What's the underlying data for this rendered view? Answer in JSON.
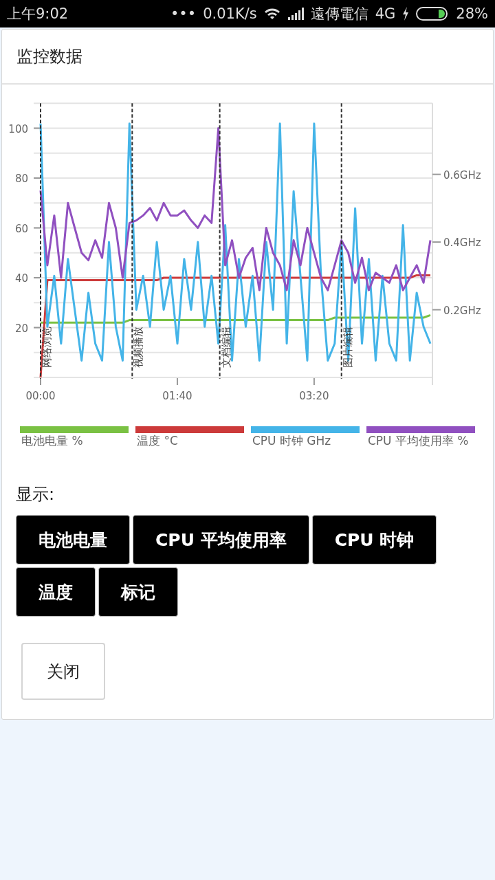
{
  "status_bar": {
    "time": "上午9:02",
    "dots": "•••",
    "speed": "0.01K/s",
    "carrier": "遠傳電信",
    "network": "4G",
    "battery": "28%"
  },
  "dialog": {
    "title": "监控数据",
    "chart": {
      "chart_data": {
        "type": "line",
        "x": [
          0,
          5,
          10,
          15,
          20,
          25,
          30,
          35,
          40,
          45,
          50,
          55,
          60,
          65,
          70,
          75,
          80,
          85,
          90,
          95,
          100,
          105,
          110,
          115,
          120,
          125,
          130,
          135,
          140,
          145,
          150,
          155,
          160,
          165,
          170,
          175,
          180,
          185,
          190,
          195,
          200,
          205,
          210,
          215,
          220,
          225,
          230,
          235,
          240,
          245,
          250,
          255,
          260,
          265,
          270,
          275,
          280,
          285
        ],
        "xlim": [
          0,
          287
        ],
        "ylim": [
          0,
          110
        ],
        "y2lim": [
          0,
          0.81
        ],
        "xticks": [
          {
            "value": 0,
            "label": "00:00"
          },
          {
            "value": 100,
            "label": "01:40"
          },
          {
            "value": 200,
            "label": "03:20"
          }
        ],
        "yticks": [
          20,
          40,
          60,
          80,
          100
        ],
        "y2ticks": [
          {
            "value": 0.2,
            "label": "0.2GHz"
          },
          {
            "value": 0.4,
            "label": "0.4GHz"
          },
          {
            "value": 0.6,
            "label": "0.6GHz"
          }
        ],
        "series": [
          {
            "name": "电池电量 %",
            "color": "#7ac143",
            "values": [
              22,
              22,
              22,
              22,
              22,
              22,
              22,
              22,
              22,
              22,
              22,
              22,
              22,
              23,
              23,
              23,
              23,
              23,
              23,
              23,
              23,
              23,
              23,
              23,
              23,
              23,
              23,
              23,
              23,
              23,
              23,
              23,
              23,
              23,
              23,
              23,
              23,
              23,
              23,
              23,
              23,
              23,
              23,
              24,
              24,
              24,
              24,
              24,
              24,
              24,
              24,
              24,
              24,
              24,
              24,
              24,
              24,
              25
            ]
          },
          {
            "name": "温度 °C",
            "color": "#cc3a3a",
            "values": [
              0,
              39,
              39,
              39,
              39,
              39,
              39,
              39,
              39,
              39,
              39,
              39,
              39,
              39,
              39,
              39,
              39,
              39,
              40,
              40,
              40,
              40,
              40,
              40,
              40,
              40,
              40,
              40,
              40,
              40,
              40,
              40,
              40,
              40,
              40,
              40,
              40,
              40,
              40,
              40,
              40,
              40,
              40,
              40,
              40,
              40,
              40,
              40,
              40,
              40,
              40,
              40,
              40,
              40,
              40,
              41,
              41,
              41
            ]
          },
          {
            "name": "CPU 时钟 GHz",
            "color": "#44b4e8",
            "axis": "y2",
            "values": [
              0.75,
              0.15,
              0.3,
              0.1,
              0.35,
              0.2,
              0.05,
              0.25,
              0.1,
              0.05,
              0.4,
              0.15,
              0.05,
              0.75,
              0.2,
              0.3,
              0.15,
              0.4,
              0.2,
              0.3,
              0.1,
              0.35,
              0.2,
              0.4,
              0.15,
              0.3,
              0.1,
              0.45,
              0.05,
              0.35,
              0.15,
              0.3,
              0.05,
              0.4,
              0.2,
              0.75,
              0.1,
              0.55,
              0.3,
              0.05,
              0.75,
              0.3,
              0.05,
              0.1,
              0.4,
              0.05,
              0.5,
              0.1,
              0.35,
              0.05,
              0.3,
              0.1,
              0.05,
              0.45,
              0.05,
              0.25,
              0.15,
              0.1
            ]
          },
          {
            "name": "CPU 平均使用率 %",
            "color": "#9050c0",
            "values": [
              75,
              45,
              65,
              40,
              70,
              60,
              50,
              47,
              55,
              48,
              70,
              60,
              40,
              62,
              63,
              65,
              68,
              63,
              70,
              65,
              65,
              67,
              63,
              60,
              65,
              62,
              100,
              45,
              55,
              40,
              48,
              52,
              35,
              60,
              50,
              45,
              35,
              55,
              45,
              60,
              50,
              40,
              35,
              45,
              55,
              50,
              38,
              48,
              35,
              42,
              40,
              38,
              45,
              35,
              40,
              45,
              38,
              55
            ]
          }
        ],
        "grid": true,
        "ref_lines": [
          {
            "axis": "x",
            "value": 0,
            "label": "网络浏览"
          },
          {
            "axis": "x",
            "value": 67,
            "label": "视频播放"
          },
          {
            "axis": "x",
            "value": 131,
            "label": "文档编辑"
          },
          {
            "axis": "x",
            "value": 220,
            "label": "图片编辑"
          }
        ]
      }
    },
    "show_label": "显示:",
    "toggles": [
      "电池电量",
      "CPU 平均使用率",
      "CPU 时钟",
      "温度",
      "标记"
    ],
    "close_button": "关闭"
  }
}
